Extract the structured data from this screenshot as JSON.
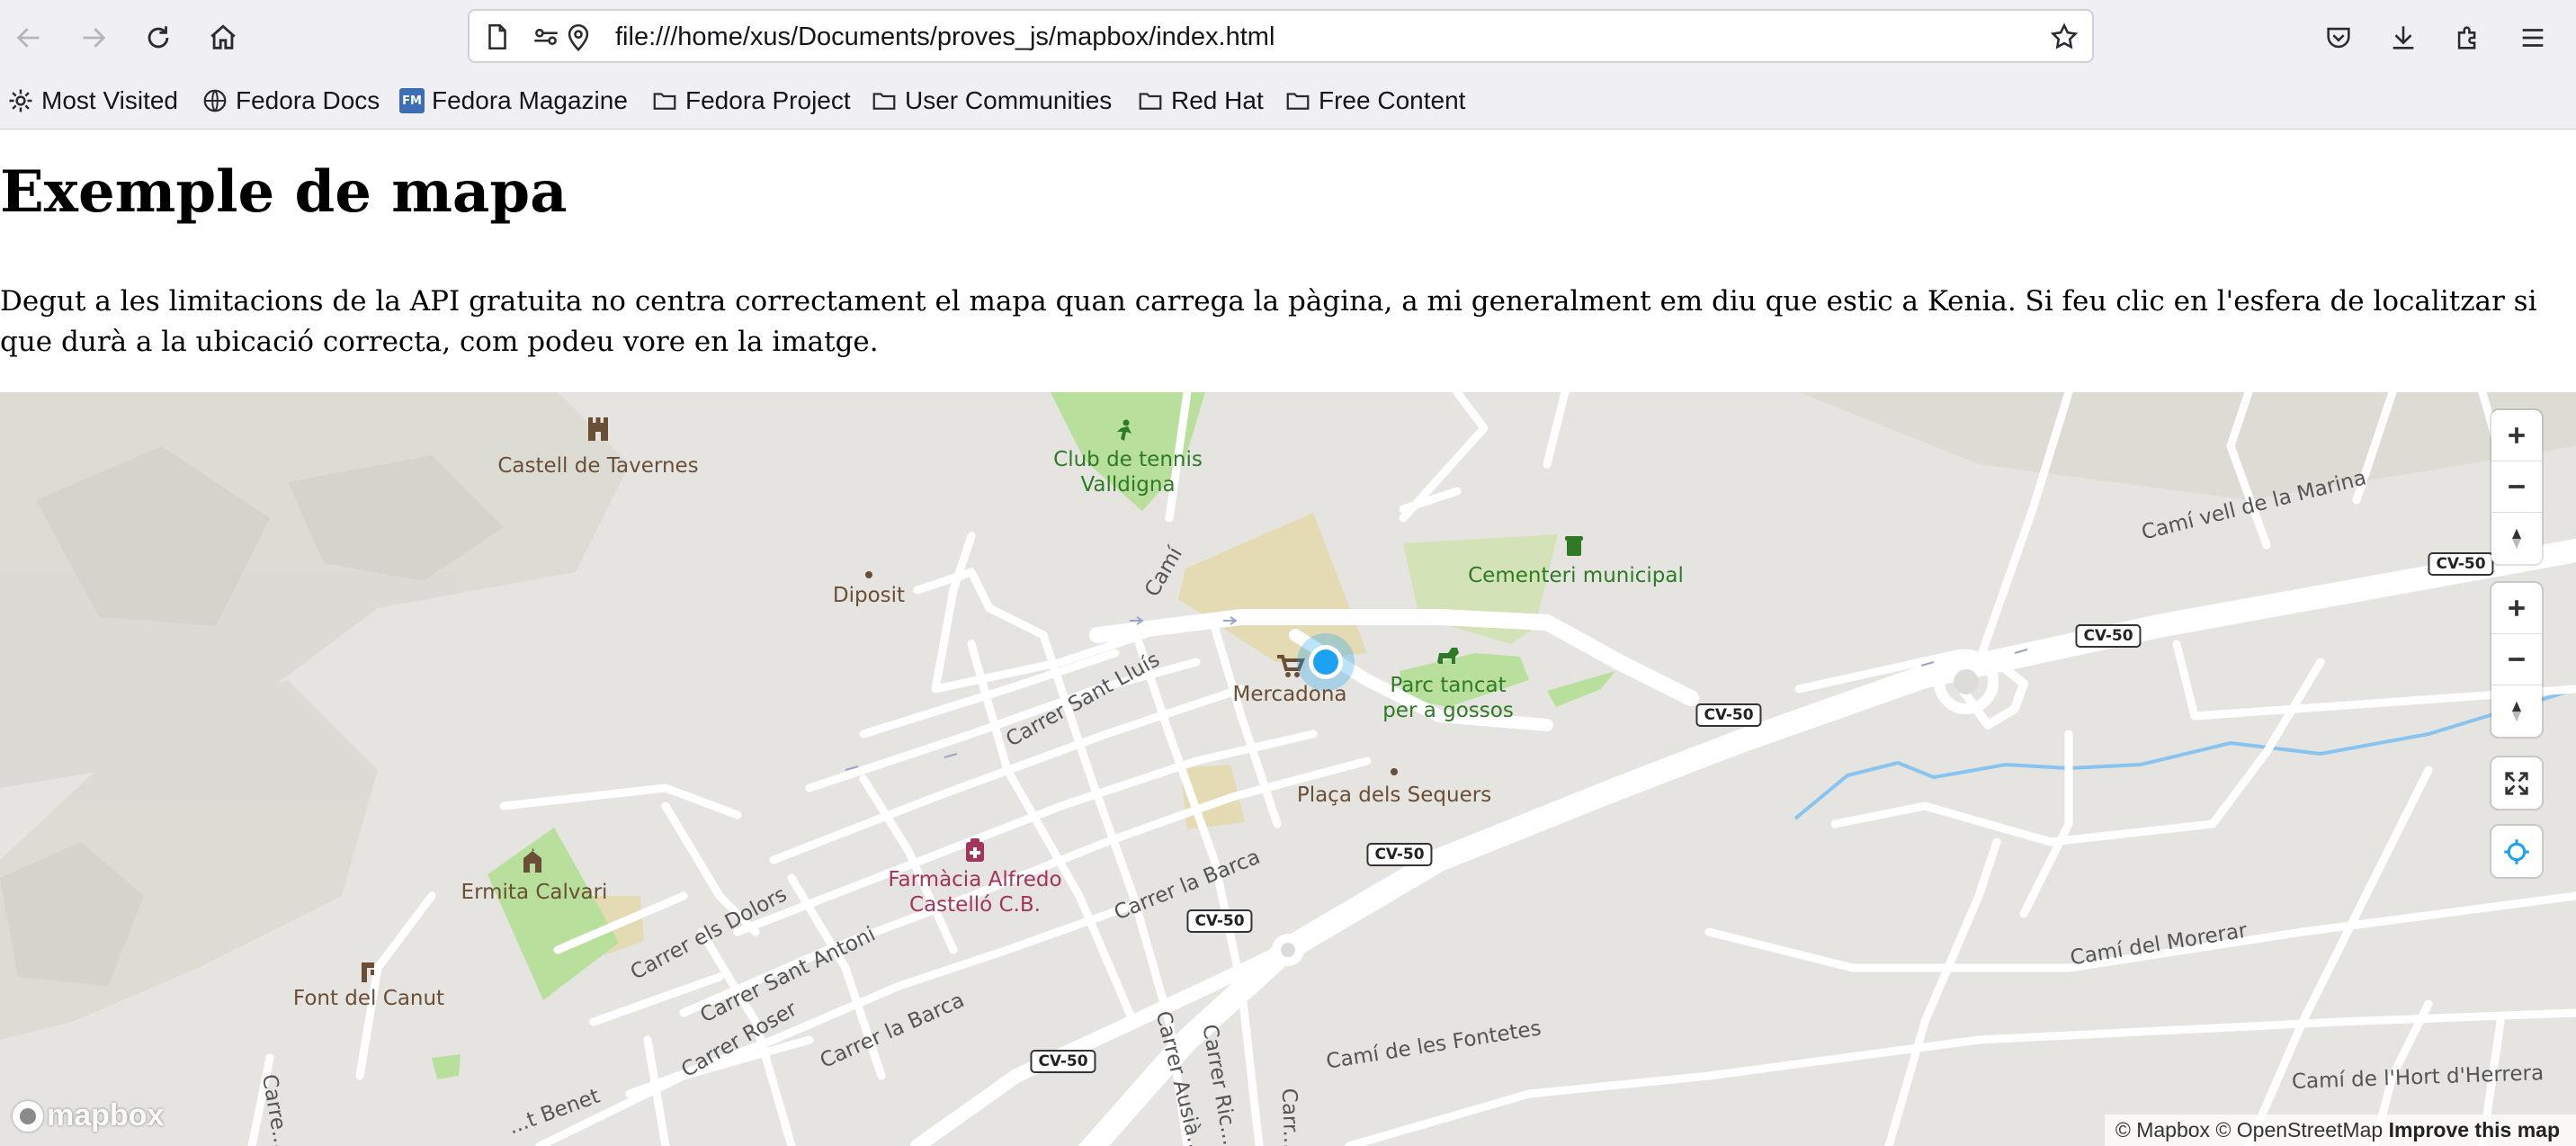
{
  "browser": {
    "url": "file:///home/xus/Documents/proves_js/mapbox/index.html",
    "bookmarks": [
      {
        "label": "Most Visited",
        "icon": "gear-icon"
      },
      {
        "label": "Fedora Docs",
        "icon": "globe-icon"
      },
      {
        "label": "Fedora Magazine",
        "icon": "fedora-magazine-icon",
        "badge": "FM"
      },
      {
        "label": "Fedora Project",
        "icon": "folder-icon"
      },
      {
        "label": "User Communities",
        "icon": "folder-icon"
      },
      {
        "label": "Red Hat",
        "icon": "folder-icon"
      },
      {
        "label": "Free Content",
        "icon": "folder-icon"
      }
    ]
  },
  "page": {
    "title": "Exemple de mapa",
    "description": "Degut a les limitacions de la API gratuita no centra correctament el mapa quan carrega la pàgina, a mi generalment em diu que estic a Kenia. Si feu clic en l'esfera de localitzar si que durà a la ubicació correcta, com podeu vore en la imatge."
  },
  "map": {
    "poi": {
      "castell": "Castell de Tavernes",
      "club_line1": "Club de tennis",
      "club_line2": "Valldigna",
      "diposit": "Diposit",
      "cementeri": "Cementeri municipal",
      "mercadona": "Mercadona",
      "parc_line1": "Parc tancat",
      "parc_line2": "per a gossos",
      "placa": "Plaça dels Sequers",
      "farmacia_line1": "Farmàcia Alfredo",
      "farmacia_line2": "Castelló C.B.",
      "ermita": "Ermita Calvari",
      "font": "Font del Canut"
    },
    "streets": {
      "cami": "Camí",
      "sant_lluis": "Carrer Sant Lluís",
      "la_barca1": "Carrer la Barca",
      "la_barca2": "Carrer la Barca",
      "dolors": "Carrer els Dolors",
      "sant_antoni": "Carrer Sant Antoni",
      "roser": "Carrer Roser",
      "benet": "...t Benet",
      "ausias": "Carrer Ausià...",
      "ric": "Carrer Ric...",
      "carr_short": "Carr...",
      "carre_left": "Carre...",
      "cami_marina": "Camí vell de la Marina",
      "cami_morerar": "Camí del Morerar",
      "cami_fontetes": "Camí de les Fontetes",
      "cami_hort": "Camí de l'Hort d'Herrera"
    },
    "shields": [
      "CV-50",
      "CV-50",
      "CV-50",
      "CV-50",
      "CV-50",
      "CV-50"
    ],
    "attribution": {
      "mapbox": "© Mapbox",
      "osm": "© OpenStreetMap",
      "improve": "Improve this map"
    },
    "logo": "mapbox",
    "colors": {
      "background": "#e5e4e0",
      "park": "#b8df9c",
      "sand": "#e4dbb4",
      "road": "#ffffff",
      "water": "#88c4ef",
      "location": "#1da1f2"
    }
  }
}
